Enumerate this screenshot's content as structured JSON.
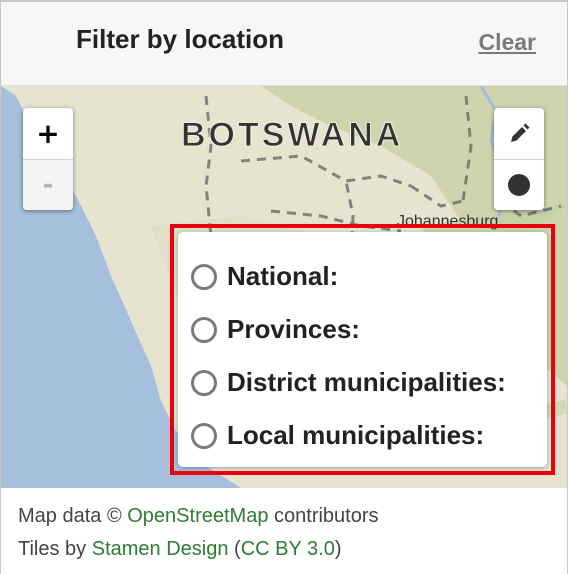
{
  "header": {
    "title": "Filter by location",
    "clear_label": "Clear"
  },
  "map": {
    "country_label": "BOTSWANA",
    "city_label": "Johannesburg",
    "zoom_in_label": "+",
    "zoom_out_label": "-",
    "zoom_out_disabled": true
  },
  "draw_controls": [
    {
      "icon": "pencil-icon"
    },
    {
      "icon": "circle-icon"
    }
  ],
  "boundary_levels": [
    {
      "label": "National:",
      "selected": false
    },
    {
      "label": "Provinces:",
      "selected": false
    },
    {
      "label": "District municipalities:",
      "selected": false
    },
    {
      "label": "Local municipalities:",
      "selected": false
    }
  ],
  "attribution": {
    "line1_prefix": "Map data © ",
    "line1_link": "OpenStreetMap",
    "line1_suffix": " contributors",
    "line2_prefix": "Tiles by ",
    "line2_link": "Stamen Design",
    "line2_mid": " (",
    "line2_link2": "CC BY 3.0",
    "line2_suffix": ")"
  },
  "colors": {
    "water": "#a5bfdd",
    "land": "#e6e4cf",
    "vegetation": "#c7d0a6",
    "highlight": "#e8000d",
    "link": "#2e7d32"
  }
}
